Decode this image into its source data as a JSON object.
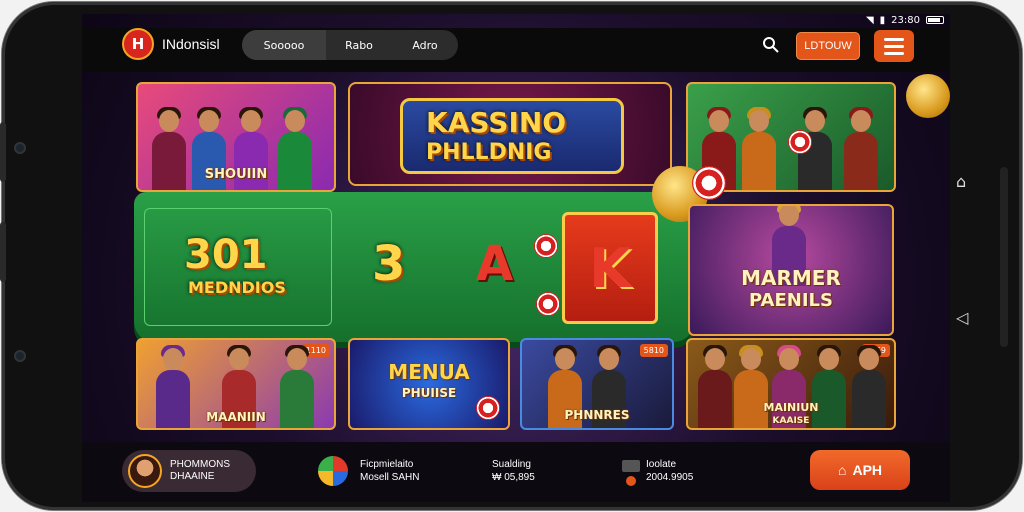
{
  "status_bar": {
    "time": "23:80"
  },
  "header": {
    "logo_glyph": "H",
    "brand": "INdonsisl",
    "tabs": [
      {
        "label": "Sooooo"
      },
      {
        "label": "Rabo"
      },
      {
        "label": "Adro"
      }
    ],
    "search_icon": "search-icon",
    "login_label": "LDTOUW",
    "menu_icon": "hamburger-icon"
  },
  "games": {
    "top_left": {
      "label": "SHOUIIN"
    },
    "feature": {
      "title_line1": "KASSINO",
      "title_line2": "PHLLDNIG"
    },
    "table": {
      "number": "301",
      "subtitle": "MEDNDIOS",
      "card_3": "3",
      "card_a": "A",
      "card_k": "K"
    },
    "right_mid": {
      "line1": "MARMER",
      "line2": "PAENILS"
    },
    "bottom_1": {
      "label": "MAANIIN",
      "badge": "1110"
    },
    "bottom_2": {
      "line1": "MENUA",
      "line2": "PHUIISE"
    },
    "bottom_3": {
      "label": "PHNNRES",
      "badge": "5810"
    },
    "bottom_4": {
      "line1": "MAINIUN",
      "line2": "KAAISE",
      "badge": "1169"
    }
  },
  "footer": {
    "profile_line1": "PHOMMONS",
    "profile_line2": "DHAAINE",
    "stat1_line1": "Ficpmielaito",
    "stat1_line2": "Mosell SAHN",
    "stat2_line1": "Sualding",
    "stat2_line2": "₩ 05,895",
    "stat3_line1": "Ioolate",
    "stat3_line2": "2004.9905",
    "app_label": "APH"
  },
  "colors": {
    "accent": "#e4551a",
    "gold": "#e9a43a",
    "felt": "#2aa048"
  }
}
